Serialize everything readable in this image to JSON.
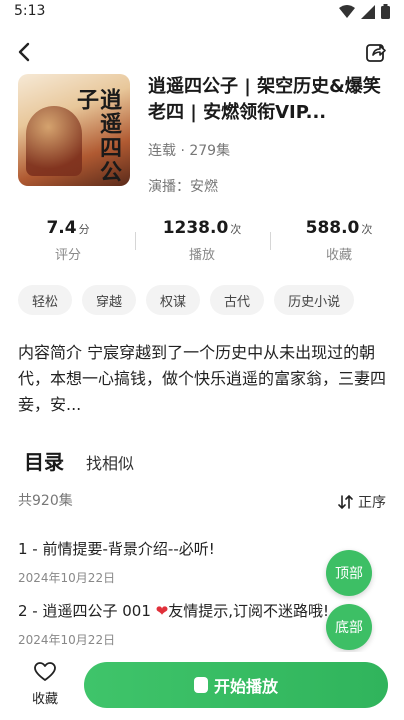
{
  "status": {
    "time": "5:13"
  },
  "book": {
    "title": "逍遥四公子 | 架空历史&爆笑老四 | 安燃领衔VIP...",
    "cover_title": "逍遥四公子",
    "meta": "连载 · 279集",
    "narrator": "演播：安燃"
  },
  "stats": [
    {
      "value": "7.4",
      "unit": "分",
      "label": "评分"
    },
    {
      "value": "1238.0",
      "unit": "次",
      "label": "播放"
    },
    {
      "value": "588.0",
      "unit": "次",
      "label": "收藏"
    }
  ],
  "tags": [
    "轻松",
    "穿越",
    "权谋",
    "古代",
    "历史小说"
  ],
  "intro": "内容简介 宁宸穿越到了一个历史中从未出现过的朝代，本想一心搞钱，做个快乐逍遥的富家翁，三妻四妾，安...",
  "tabs": {
    "catalog": "目录",
    "similar": "找相似"
  },
  "catalog": {
    "count": "共920集",
    "sort_label": "正序",
    "episodes": [
      {
        "title": "1 - 前情提要-背景介绍--必听!",
        "date": "2024年10月22日"
      },
      {
        "title_pre": "2 - 逍遥四公子 001 ",
        "heart": "❤",
        "title_post": "友情提示,订阅不迷路哦!",
        "date": "2024年10月22日"
      }
    ]
  },
  "floating": {
    "top": "顶部",
    "bottom": "底部"
  },
  "bottom_bar": {
    "fav_label": "收藏",
    "play_label": "开始播放"
  },
  "colors": {
    "accent": "#3dbf65",
    "heart": "#e0303a"
  },
  "icons": {
    "back": "chevron-left-icon",
    "share": "share-icon",
    "sort": "sort-icon",
    "favorite": "heart-outline-icon",
    "play": "play-icon"
  }
}
